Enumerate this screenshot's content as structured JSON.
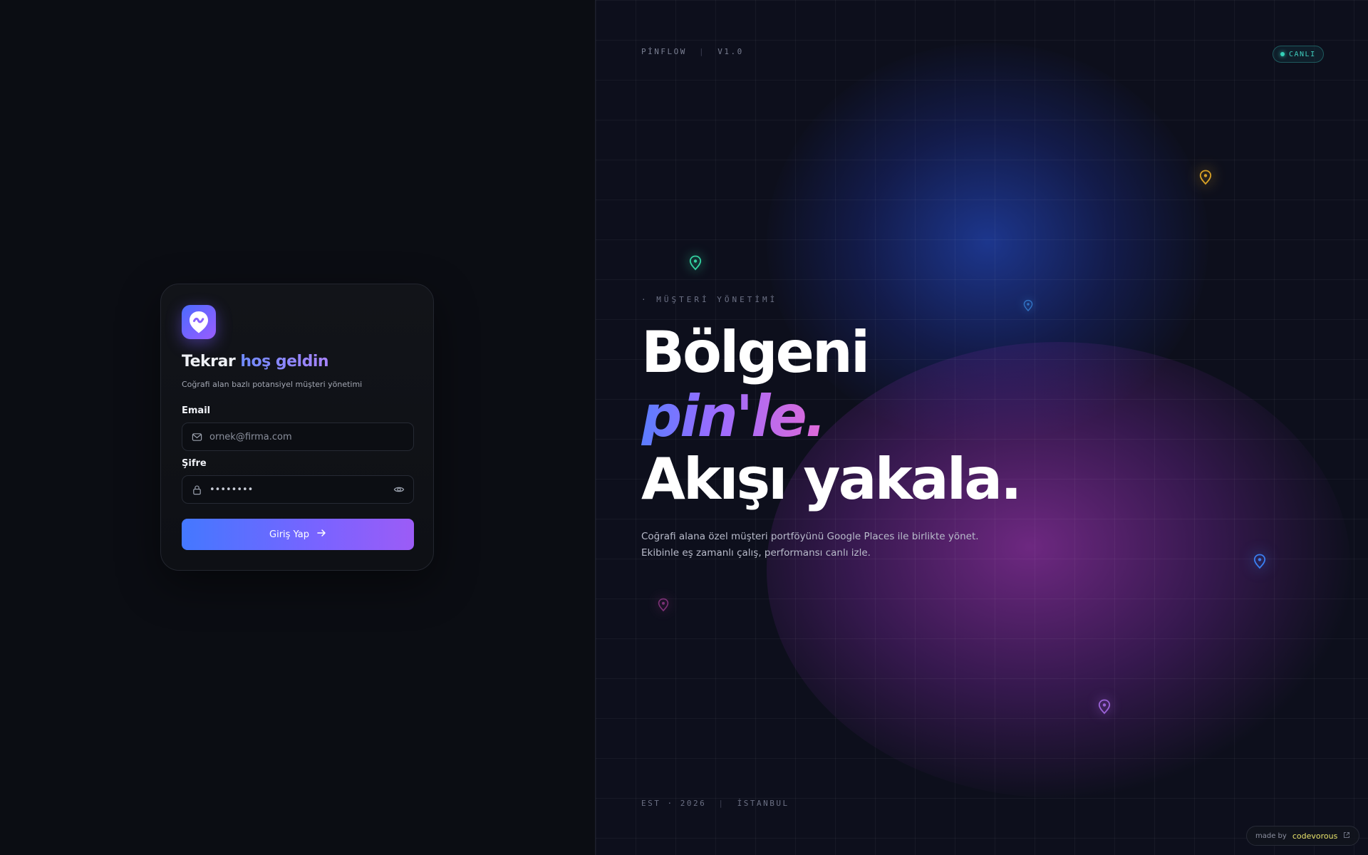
{
  "login": {
    "title_part1": "Tekrar",
    "title_part2": "hoş geldin",
    "subtitle": "Coğrafi alan bazlı potansiyel müşteri yönetimi",
    "email_label": "Email",
    "email_placeholder": "ornek@firma.com",
    "password_label": "Şifre",
    "password_value": "••••••••",
    "submit_label": "Giriş Yap"
  },
  "hero": {
    "brand": "PİNFLOW",
    "version": "V1.0",
    "live_badge": "CANLI",
    "eyebrow": "· MÜŞTERİ YÖNETİMİ",
    "headline_line1": "Bölgeni",
    "headline_line2": "pin'le.",
    "headline_line3": "Akışı yakala.",
    "description_line1": "Coğrafi alana özel müşteri portföyünü Google Places ile birlikte yönet.",
    "description_line2": "Ekibinle eş zamanlı çalış, performansı canlı izle.",
    "footer_est": "EST · 2026",
    "footer_city": "İSTANBUL",
    "made_by_prefix": "made by",
    "made_by_brand": "codevorous"
  },
  "colors": {
    "accent_blue": "#4478ff",
    "accent_purple": "#9c5cf6",
    "live_green": "#34d1b8",
    "brand_yellow": "#e8e36a"
  },
  "icons": {
    "logo": "map-pin-wave-icon",
    "email": "mail-icon",
    "password": "lock-icon",
    "toggle_password": "eye-icon",
    "submit": "arrow-right-icon",
    "external": "external-link-icon"
  }
}
